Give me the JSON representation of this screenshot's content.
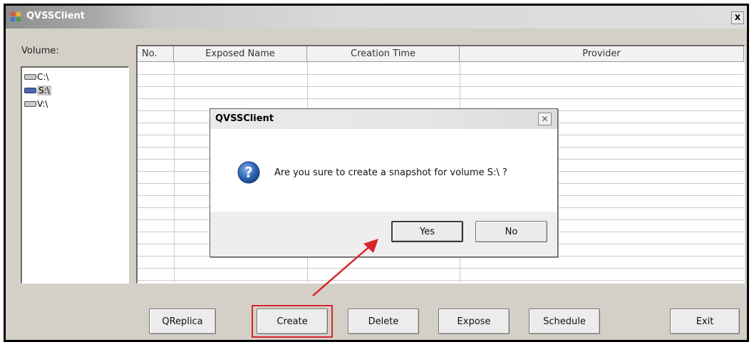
{
  "window": {
    "title": "QVSSClient",
    "close_symbol": "x",
    "icon": "app-icon"
  },
  "volumes": {
    "label": "Volume:",
    "items": [
      {
        "label": "C:\\",
        "selected": false
      },
      {
        "label": "S:\\",
        "selected": true
      },
      {
        "label": "V:\\",
        "selected": false
      }
    ]
  },
  "grid": {
    "columns": [
      "No.",
      "Exposed Name",
      "Creation Time",
      "Provider"
    ],
    "rows": []
  },
  "buttons": {
    "qreplica": "QReplica",
    "create": "Create",
    "delete": "Delete",
    "expose": "Expose",
    "schedule": "Schedule",
    "exit": "Exit"
  },
  "dialog": {
    "title": "QVSSClient",
    "close_symbol": "✕",
    "icon": "question-icon",
    "message": "Are you sure to create a snapshot for volume S:\\ ?",
    "yes": "Yes",
    "no": "No"
  },
  "colors": {
    "highlight": "#d9262b",
    "question_icon": "#2f64b4"
  }
}
